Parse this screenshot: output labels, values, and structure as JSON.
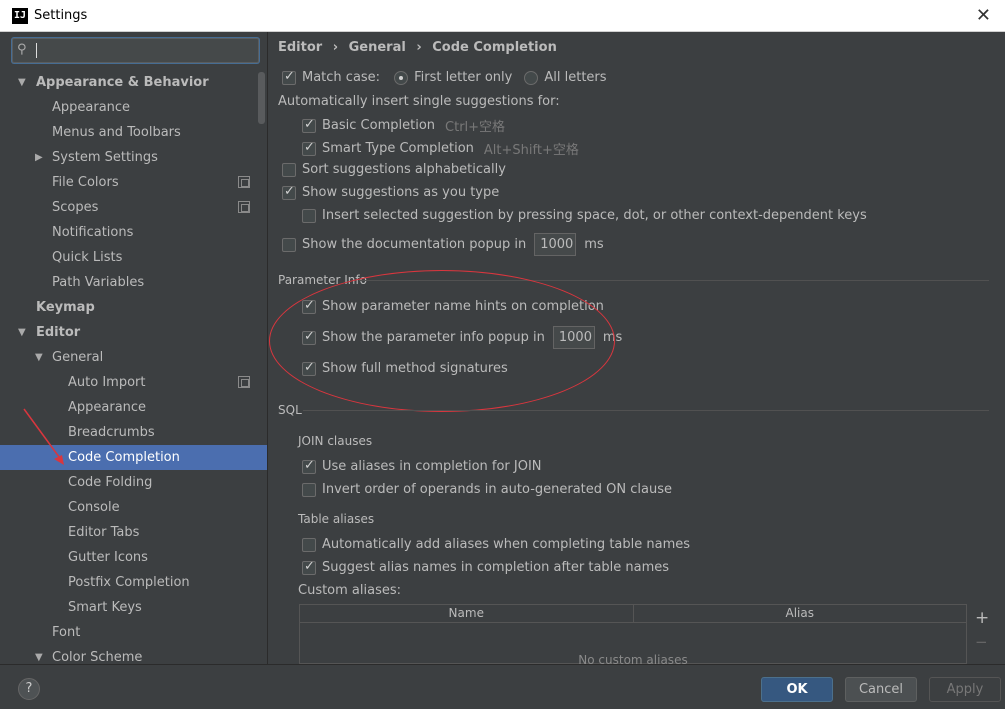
{
  "window": {
    "title": "Settings",
    "app_icon": "IJ"
  },
  "search": {
    "value": "",
    "icon": "search-icon"
  },
  "tree": [
    {
      "label": "Appearance & Behavior",
      "indent": 0,
      "arrow": "▼",
      "bold": true
    },
    {
      "label": "Appearance",
      "indent": 1
    },
    {
      "label": "Menus and Toolbars",
      "indent": 1
    },
    {
      "label": "System Settings",
      "indent": 1,
      "arrow": "▶"
    },
    {
      "label": "File Colors",
      "indent": 1,
      "project": true
    },
    {
      "label": "Scopes",
      "indent": 1,
      "project": true
    },
    {
      "label": "Notifications",
      "indent": 1
    },
    {
      "label": "Quick Lists",
      "indent": 1
    },
    {
      "label": "Path Variables",
      "indent": 1
    },
    {
      "label": "Keymap",
      "indent": 0,
      "bold": true
    },
    {
      "label": "Editor",
      "indent": 0,
      "arrow": "▼",
      "bold": true
    },
    {
      "label": "General",
      "indent": 1,
      "arrow": "▼"
    },
    {
      "label": "Auto Import",
      "indent": 2,
      "project": true
    },
    {
      "label": "Appearance",
      "indent": 2
    },
    {
      "label": "Breadcrumbs",
      "indent": 2
    },
    {
      "label": "Code Completion",
      "indent": 2,
      "selected": true
    },
    {
      "label": "Code Folding",
      "indent": 2
    },
    {
      "label": "Console",
      "indent": 2
    },
    {
      "label": "Editor Tabs",
      "indent": 2
    },
    {
      "label": "Gutter Icons",
      "indent": 2
    },
    {
      "label": "Postfix Completion",
      "indent": 2
    },
    {
      "label": "Smart Keys",
      "indent": 2
    },
    {
      "label": "Font",
      "indent": 1
    },
    {
      "label": "Color Scheme",
      "indent": 1,
      "arrow": "▼"
    }
  ],
  "breadcrumb": {
    "a": "Editor",
    "b": "General",
    "c": "Code Completion",
    "sep": "›"
  },
  "completion": {
    "match_case": "Match case:",
    "first_letter": "First letter only",
    "all_letters": "All letters",
    "auto_insert": "Automatically insert single suggestions for:",
    "basic": "Basic Completion",
    "basic_sc": "Ctrl+空格",
    "smart": "Smart Type Completion",
    "smart_sc": "Alt+Shift+空格",
    "sort": "Sort suggestions alphabetically",
    "show_as_type": "Show suggestions as you type",
    "insert_selected": "Insert selected suggestion by pressing space, dot, or other context-dependent keys",
    "doc_popup": "Show the documentation popup in",
    "doc_popup_value": "1000",
    "ms": "ms"
  },
  "param_info": {
    "title": "Parameter Info",
    "hints": "Show parameter name hints on completion",
    "popup": "Show the parameter info popup in",
    "popup_value": "1000",
    "ms": "ms",
    "full_sig": "Show full method signatures"
  },
  "sql": {
    "title": "SQL",
    "join_clauses": "JOIN clauses",
    "use_aliases": "Use aliases in completion for JOIN",
    "invert_order": "Invert order of operands in auto-generated ON clause",
    "table_aliases": "Table aliases",
    "auto_add": "Automatically add aliases when completing table names",
    "suggest": "Suggest alias names in completion after table names",
    "custom": "Custom aliases:",
    "col_name": "Name",
    "col_alias": "Alias",
    "empty": "No custom aliases",
    "plus": "+",
    "minus": "−"
  },
  "buttons": {
    "help": "?",
    "ok": "OK",
    "cancel": "Cancel",
    "apply": "Apply"
  },
  "colors": {
    "selection": "#4b6eaf",
    "annotation": "#d9363e",
    "ok": "#365880"
  }
}
